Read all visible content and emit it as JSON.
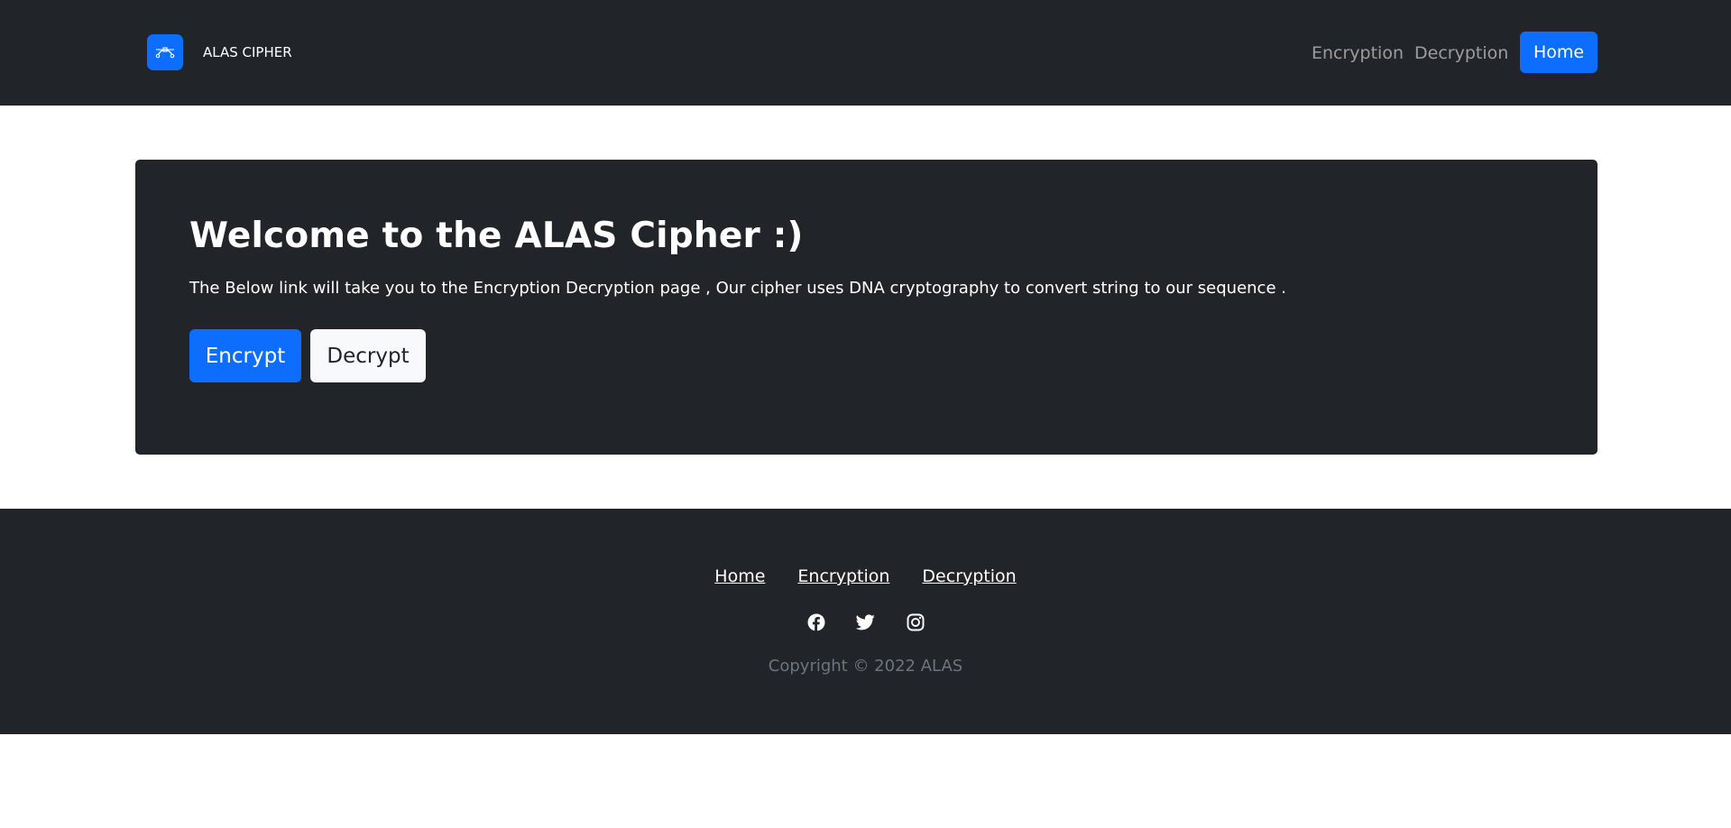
{
  "navbar": {
    "brand_icon": "bezier-curve-icon",
    "brand_name": "ALAS CIPHER",
    "links": [
      "Encryption",
      "Decryption"
    ],
    "home_button": "Home"
  },
  "hero": {
    "title": "Welcome to the ALAS Cipher :)",
    "description": "The Below link will take you to the Encryption Decryption page , Our cipher uses DNA cryptography to convert string to our sequence .",
    "encrypt_button": "Encrypt",
    "decrypt_button": "Decrypt"
  },
  "footer": {
    "links": [
      "Home",
      "Encryption",
      "Decryption"
    ],
    "social_icons": [
      "facebook-icon",
      "twitter-icon",
      "instagram-icon"
    ],
    "copyright": "Copyright © 2022 ALAS"
  },
  "colors": {
    "dark": "#212529",
    "primary": "#0d6efd",
    "light": "#f8f9fa",
    "muted": "#6c757d"
  }
}
